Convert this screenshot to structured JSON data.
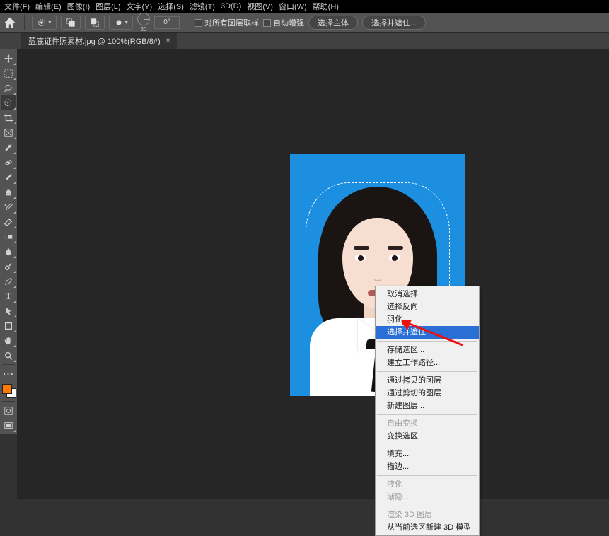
{
  "menu": {
    "file": "文件(F)",
    "edit": "编辑(E)",
    "image": "图像(I)",
    "layer": "图层(L)",
    "type": "文字(Y)",
    "select": "选择(S)",
    "filter": "滤镜(T)",
    "three_d": "3D(D)",
    "view": "视图(V)",
    "window": "窗口(W)",
    "help": "帮助(H)"
  },
  "options": {
    "angle_label": "30",
    "angle_value": "0°",
    "sample_all": "对所有图层取样",
    "auto_enhance": "自动增强",
    "select_subject": "选择主体",
    "select_and_mask": "选择并遮住..."
  },
  "tab": {
    "title": "蓝底证件照素材.jpg @ 100%(RGB/8#)",
    "close": "×"
  },
  "context_menu": {
    "deselect": "取消选择",
    "inverse": "选择反向",
    "feather": "羽化...",
    "select_and_mask": "选择并遮住...",
    "save_selection": "存储选区...",
    "make_work_path": "建立工作路径...",
    "layer_via_copy": "通过拷贝的图层",
    "layer_via_cut": "通过剪切的图层",
    "new_layer": "新建图层...",
    "free_transform": "自由变换",
    "transform_selection": "变换选区",
    "fill": "填充...",
    "stroke": "描边...",
    "liquify": "液化",
    "fade": "渐隐...",
    "render_3d_layer": "渲染 3D 图层",
    "new_3d_from_sel": "从当前选区新建 3D 模型"
  },
  "tools": {
    "move": "move-tool",
    "marquee": "marquee-tool",
    "lasso": "lasso-tool",
    "quick_select": "quick-selection-tool",
    "crop": "crop-tool",
    "frame": "frame-tool",
    "eyedropper": "eyedropper-tool",
    "healing": "healing-brush-tool",
    "brush": "brush-tool",
    "stamp": "clone-stamp-tool",
    "history": "history-brush-tool",
    "eraser": "eraser-tool",
    "gradient": "gradient-tool",
    "blur": "blur-tool",
    "dodge": "dodge-tool",
    "pen": "pen-tool",
    "text": "text-tool",
    "path": "path-selection-tool",
    "shape": "shape-tool",
    "hand": "hand-tool",
    "zoom": "zoom-tool"
  },
  "colors": {
    "foreground": "#ff7a00",
    "background": "#ffffff",
    "canvas_blue": "#1d8fe1",
    "highlight": "#2a6fd6"
  }
}
